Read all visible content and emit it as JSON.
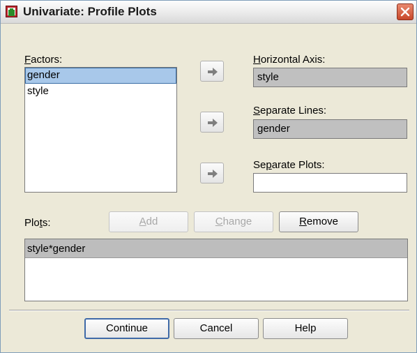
{
  "window": {
    "title": "Univariate: Profile Plots",
    "icon": "spss-dialog-icon",
    "close_icon": "close-icon"
  },
  "factors": {
    "label_key": "F",
    "label_rest": "actors:",
    "items": [
      {
        "label": "gender",
        "selected": true
      },
      {
        "label": "style",
        "selected": false
      }
    ]
  },
  "horizontal_axis": {
    "label_key": "H",
    "label_rest": "orizontal Axis:",
    "value": "style"
  },
  "separate_lines": {
    "label_key": "S",
    "label_rest": "eparate Lines:",
    "value": "gender"
  },
  "separate_plots": {
    "label_pre": "Se",
    "label_key": "p",
    "label_rest": "arate Plots:",
    "value": ""
  },
  "plots": {
    "label_pre": "Plo",
    "label_key": "t",
    "label_rest": "s:",
    "items": [
      "style*gender"
    ]
  },
  "buttons": {
    "add_key": "A",
    "add_rest": "dd",
    "change_key": "C",
    "change_rest": "hange",
    "remove_key": "R",
    "remove_rest": "emove",
    "continue": "Continue",
    "cancel": "Cancel",
    "help": "Help"
  },
  "icons": {
    "move_arrow": "move-right-arrow-icon"
  },
  "colors": {
    "dialog_bg": "#ece9d8",
    "selection": "#a8c8ea",
    "filled_field": "#c0c0c0",
    "close_red": "#c8472a"
  }
}
